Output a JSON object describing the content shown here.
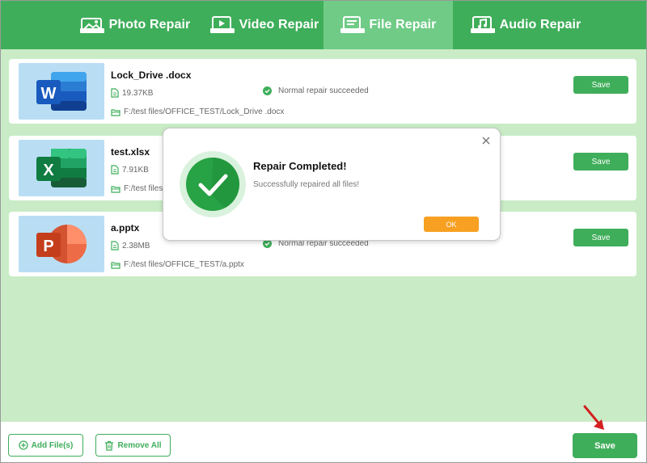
{
  "tabs": [
    {
      "label": "Photo Repair",
      "icon": "photo-repair-icon",
      "active": false
    },
    {
      "label": "Video Repair",
      "icon": "video-repair-icon",
      "active": false
    },
    {
      "label": "File Repair",
      "icon": "file-repair-icon",
      "active": true
    },
    {
      "label": "Audio Repair",
      "icon": "audio-repair-icon",
      "active": false
    }
  ],
  "files": [
    {
      "name": "Lock_Drive .docx",
      "size": "19.37KB",
      "path": "F:/test files/OFFICE_TEST/Lock_Drive .docx",
      "status": "Normal repair succeeded",
      "icon": "word-icon",
      "save_label": "Save"
    },
    {
      "name": "test.xlsx",
      "size": "7.91KB",
      "path": "F:/test files",
      "status": "",
      "icon": "excel-icon",
      "save_label": "Save"
    },
    {
      "name": "a.pptx",
      "size": "2.38MB",
      "path": "F:/test files/OFFICE_TEST/a.pptx",
      "status": "Normal repair succeeded",
      "icon": "powerpoint-icon",
      "save_label": "Save"
    }
  ],
  "modal": {
    "title": "Repair Completed!",
    "message": "Successfully repaired all files!",
    "ok_label": "OK"
  },
  "bottom": {
    "add_label": "Add File(s)",
    "remove_label": "Remove All",
    "save_label": "Save"
  },
  "colors": {
    "brand_green": "#3fae5a",
    "active_tab": "#6fcb86",
    "background": "#c9ecc6",
    "ok_orange": "#f7a022",
    "arrow_red": "#d42020"
  }
}
